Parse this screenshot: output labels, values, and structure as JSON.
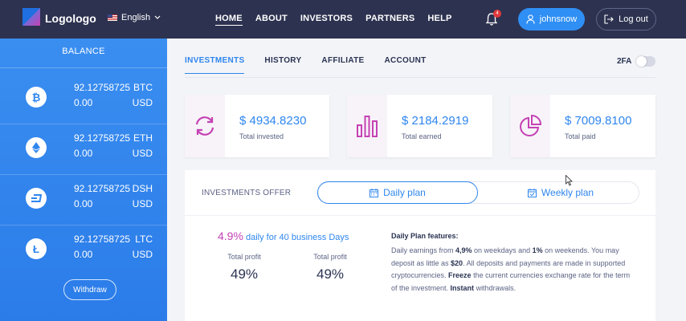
{
  "header": {
    "logo_text": "Logologo",
    "language": "English",
    "nav": [
      {
        "label": "HOME",
        "active": true
      },
      {
        "label": "ABOUT",
        "active": false
      },
      {
        "label": "INVESTORS",
        "active": false
      },
      {
        "label": "PARTNERS",
        "active": false
      },
      {
        "label": "HELP",
        "active": false
      }
    ],
    "notification_count": "4",
    "username": "johnsnow",
    "logout_label": "Log out"
  },
  "sidebar": {
    "title": "BALANCE",
    "coins": [
      {
        "icon": "bitcoin-icon",
        "amount": "92.12758725",
        "currency": "BTC",
        "usd_amount": "0.00",
        "usd_label": "USD"
      },
      {
        "icon": "ethereum-icon",
        "amount": "92.12758725",
        "currency": "ETH",
        "usd_amount": "0.00",
        "usd_label": "USD"
      },
      {
        "icon": "dash-icon",
        "amount": "92.12758725",
        "currency": "DSH",
        "usd_amount": "0.00",
        "usd_label": "USD"
      },
      {
        "icon": "litecoin-icon",
        "amount": "92.12758725",
        "currency": "LTC",
        "usd_amount": "0.00",
        "usd_label": "USD"
      }
    ],
    "withdraw_label": "Withdraw"
  },
  "tabs": [
    {
      "label": "INVESTMENTS",
      "active": true
    },
    {
      "label": "HISTORY",
      "active": false
    },
    {
      "label": "AFFILIATE",
      "active": false
    },
    {
      "label": "ACCOUNT",
      "active": false
    }
  ],
  "twofa_label": "2FA",
  "stats": [
    {
      "icon": "refresh-icon",
      "value": "$ 4934.8230",
      "label": "Total invested"
    },
    {
      "icon": "bar-chart-icon",
      "value": "$ 2184.2919",
      "label": "Total earned"
    },
    {
      "icon": "pie-chart-icon",
      "value": "$ 7009.8100",
      "label": "Total paid"
    }
  ],
  "offer": {
    "label": "INVESTMENTS OFFER",
    "daily_plan": "Daily plan",
    "weekly_plan": "Weekly plan",
    "rate_percent": "4.9%",
    "rate_text": "daily for 40 business Days",
    "profits": [
      {
        "label": "Total profit",
        "value": "49%"
      },
      {
        "label": "Total profit",
        "value": "49%"
      }
    ],
    "features_title": "Daily Plan features:",
    "features": {
      "t1": "Daily earnings from ",
      "b1": "4,9%",
      "t2": " on weekdays and ",
      "b2": "1%",
      "t3": " on weekends. You may deposit as little as ",
      "b3": "$20",
      "t4": ". All deposits and payments are made in supported cryptocurrencies. ",
      "b4": "Freeze",
      "t5": " the current currencies exchange rate for the term of the investment. ",
      "b5": "Instant",
      "t6": " withdrawals."
    }
  },
  "colors": {
    "accent": "#2f86ee",
    "header_bg": "#2d3250",
    "highlight": "#c542b4"
  }
}
